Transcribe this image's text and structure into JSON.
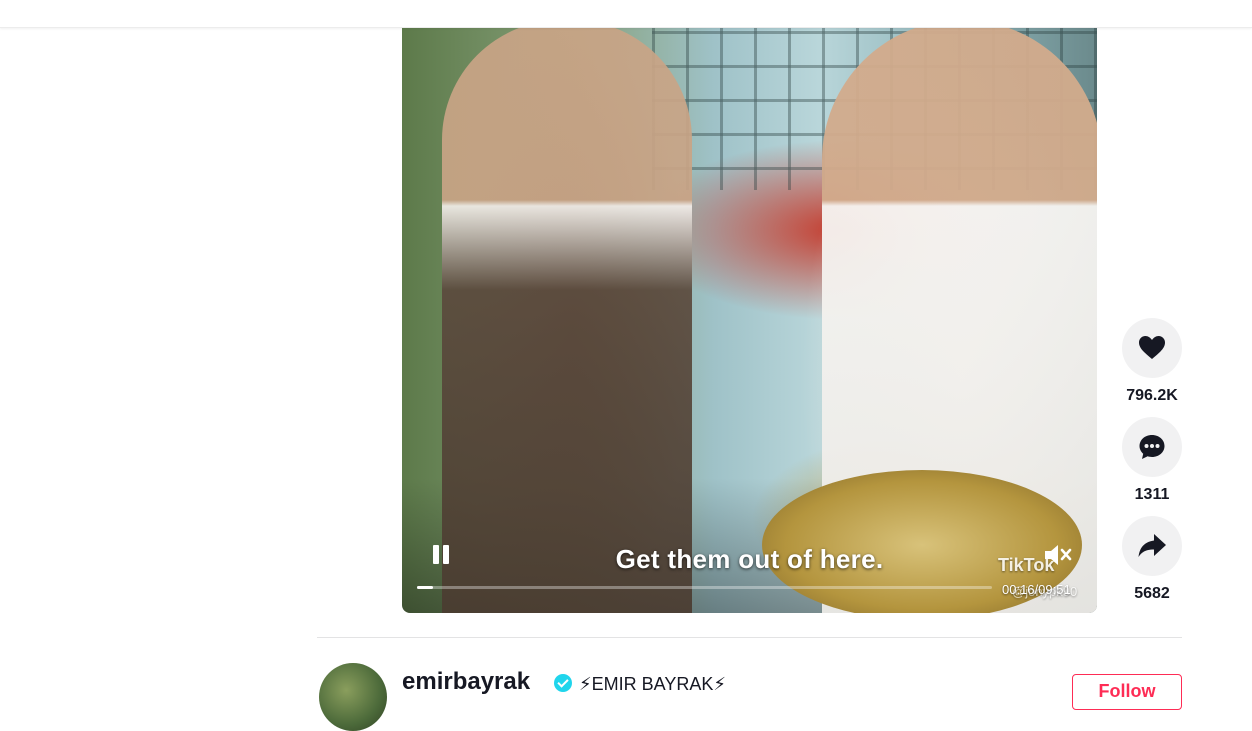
{
  "video": {
    "subtitle": "Get them out of here.",
    "timecode": "00:16/09:51",
    "watermark_brand": "TikTok",
    "watermark_handle": "@jonypk90",
    "progress_fraction": 0.027,
    "controls": {
      "play_pause_icon": "pause-icon",
      "volume_icon": "muted-speaker-icon"
    }
  },
  "actions": [
    {
      "name": "like",
      "icon": "heart-icon",
      "count": "796.2K"
    },
    {
      "name": "comment",
      "icon": "comment-bubble-icon",
      "count": "1311"
    },
    {
      "name": "share",
      "icon": "share-arrow-icon",
      "count": "5682"
    }
  ],
  "author": {
    "username": "emirbayrak",
    "nickname": "⚡EMIR BAYRAK⚡",
    "follow_label": "Follow"
  },
  "colors": {
    "accent": "#fe2c55",
    "text": "#161823",
    "action_bg": "#f1f1f2"
  }
}
